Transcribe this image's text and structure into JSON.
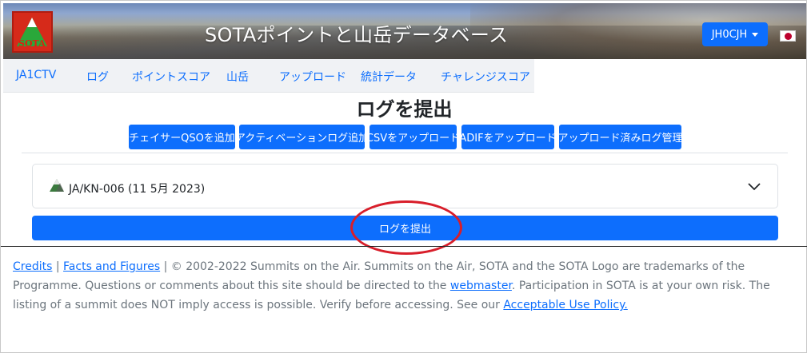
{
  "header": {
    "site_title": "SOTAポイントと山岳データベース",
    "logo_text": "SOTA",
    "user_button": "JH0CJH",
    "flag": "japan-flag"
  },
  "nav": {
    "items": [
      "JA1CTV",
      "ログ",
      "ポイントスコア",
      "山岳",
      "アップロード",
      "統計データ",
      "チャレンジスコア"
    ]
  },
  "main": {
    "title": "ログを提出",
    "buttons": [
      "チェイサーQSOを追加",
      "アクティベーションログ追加",
      "CSVをアップロード",
      "ADIFをアップロード",
      "アップロード済みログ管理"
    ],
    "accordion_label": "JA/KN-006 (11 5月 2023)",
    "submit_label": "ログを提出"
  },
  "footer": {
    "credits": "Credits",
    "sep1": " | ",
    "facts": "Facts and Figures",
    "text1": " | © 2002-2022 Summits on the Air. Summits on the Air, SOTA and the SOTA Logo are trademarks of the Programme. Questions or comments about this site should be directed to the ",
    "webmaster": "webmaster",
    "text2": ". Participation in SOTA is at your own risk. The listing of a summit does NOT imply access is possible. Verify before accessing. See our ",
    "aup": "Acceptable Use Policy."
  },
  "colors": {
    "primary": "#0d6efd",
    "annotation": "#d81e2a"
  }
}
